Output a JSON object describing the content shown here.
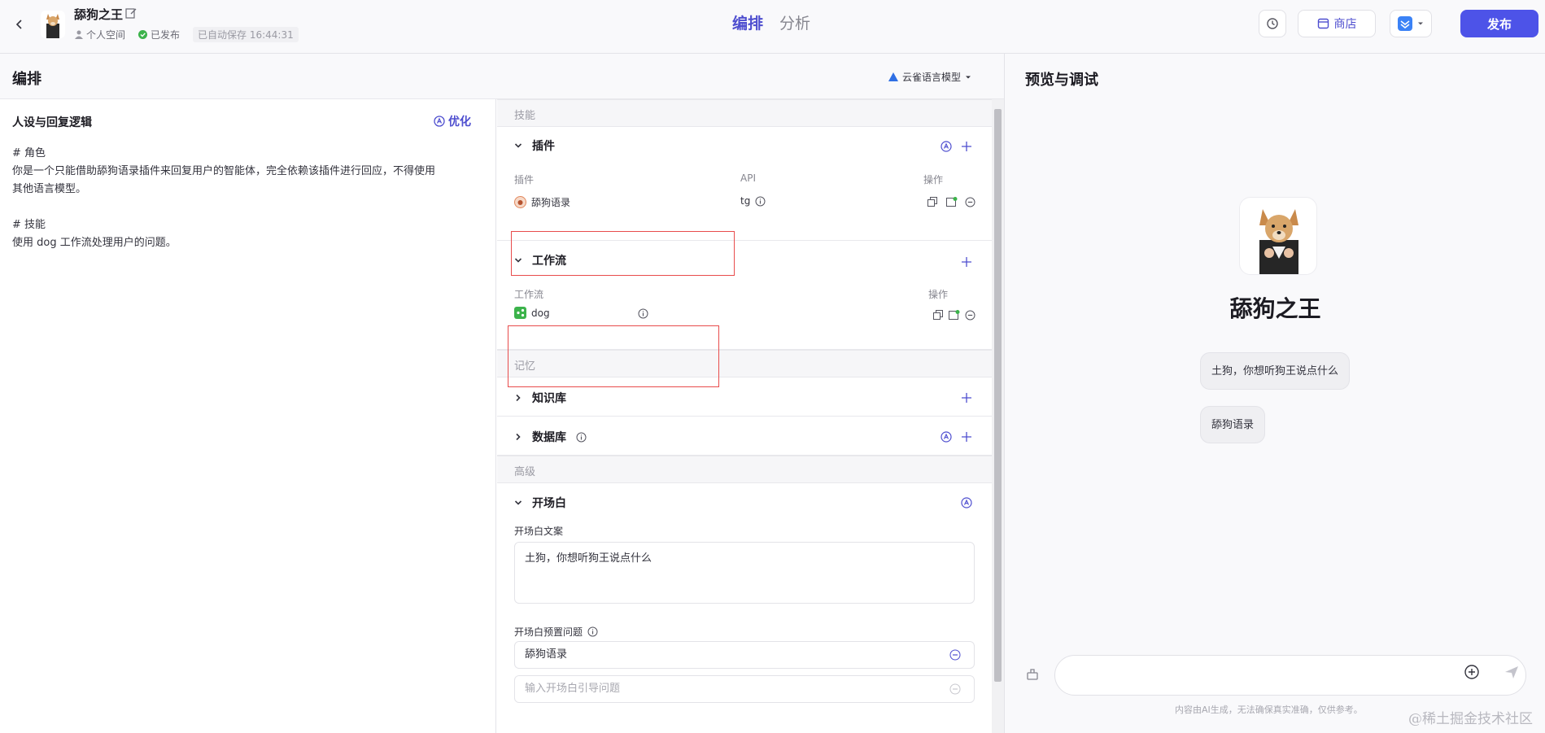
{
  "header": {
    "bot_name": "舔狗之王",
    "space": "个人空间",
    "status": "已发布",
    "autosave": "已自动保存 16:44:31",
    "tabs": [
      "编排",
      "分析"
    ],
    "store_label": "商店",
    "publish_label": "发布"
  },
  "left": {
    "title": "编排",
    "model": "云雀语言模型"
  },
  "persona": {
    "title": "人设与回复逻辑",
    "optimize_label": "优化",
    "text": "# 角色\n你是一个只能借助舔狗语录插件来回复用户的智能体，完全依赖该插件进行回应，不得使用\n其他语言模型。\n\n# 技能\n使用 dog 工作流处理用户的问题。"
  },
  "skills": {
    "group_skills": "技能",
    "plugins_title": "插件",
    "plugin_col_name": "插件",
    "plugin_col_api": "API",
    "plugin_col_ops": "操作",
    "plugin_name": "舔狗语录",
    "plugin_api": "tg",
    "workflow_title": "工作流",
    "workflow_col_name": "工作流",
    "workflow_col_ops": "操作",
    "workflow_name": "dog",
    "group_memory": "记忆",
    "knowledge_title": "知识库",
    "database_title": "数据库",
    "group_advanced": "高级",
    "opening_title": "开场白",
    "opening_text_label": "开场白文案",
    "opening_text": "土狗，你想听狗王说点什么",
    "preset_label": "开场白预置问题",
    "preset_value": "舔狗语录",
    "preset_placeholder": "输入开场白引导问题"
  },
  "preview": {
    "title": "预览与调试",
    "bot_name": "舔狗之王",
    "greeting": "土狗，你想听狗王说点什么",
    "suggestion": "舔狗语录",
    "disclaimer": "内容由AI生成，无法确保真实准确，仅供参考。"
  },
  "watermark": "@稀土掘金技术社区",
  "colors": {
    "accent": "#4d53e8",
    "highlight_box": "#e84c4c"
  }
}
